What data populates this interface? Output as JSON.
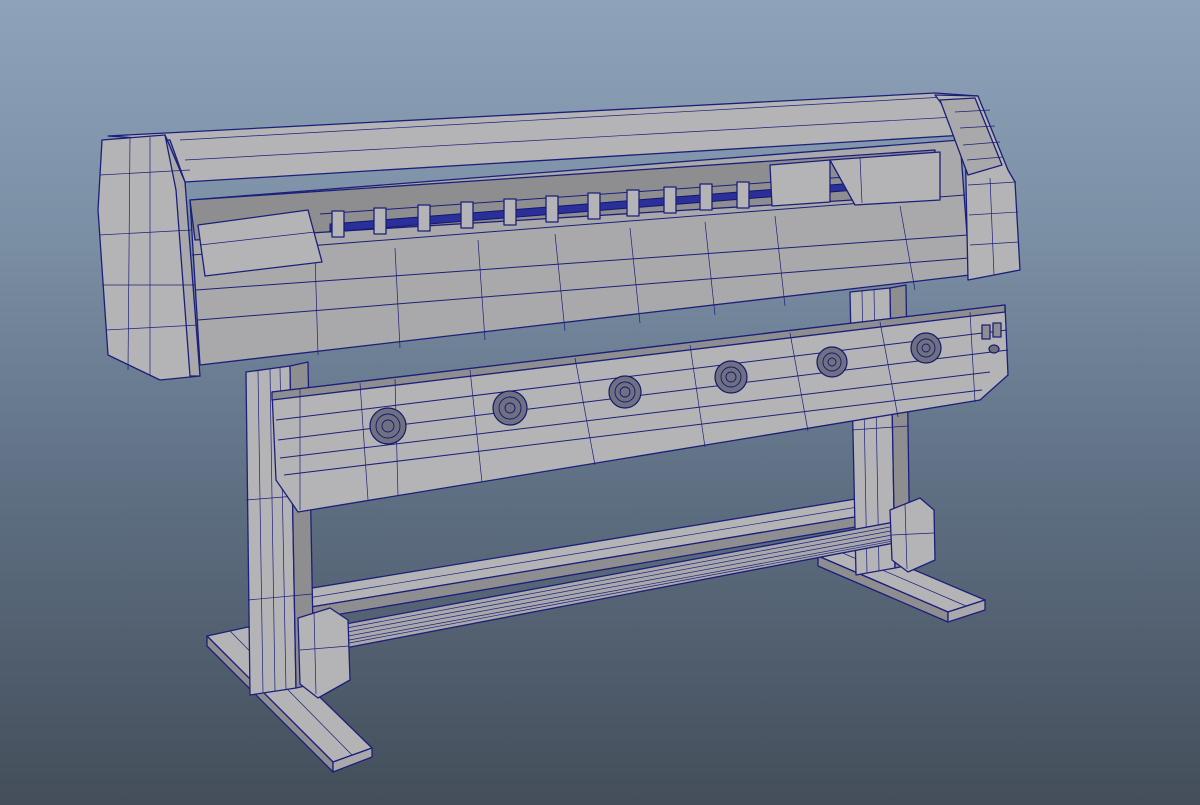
{
  "viewport": {
    "background_top": "#8ea2b9",
    "background_bottom": "#444e5a",
    "wireframe_color": "#1c1f7a",
    "shaded_surface_color": "#a9a9ab"
  },
  "model": {
    "subject": "wide-format-printer-on-stand",
    "fan_count": 6,
    "carriage_clips": 11
  }
}
